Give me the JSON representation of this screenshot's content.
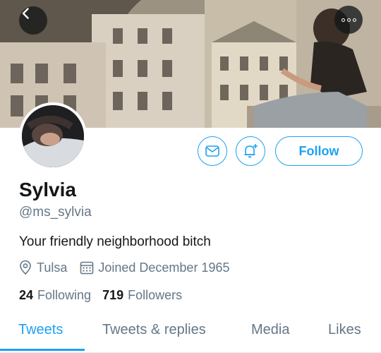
{
  "profile": {
    "display_name": "Sylvia",
    "handle": "@ms_sylvia",
    "bio": "Your friendly neighborhood bitch",
    "location": "Tulsa",
    "joined": "Joined December 1965",
    "following_count": "24",
    "following_label": "Following",
    "followers_count": "719",
    "followers_label": "Followers"
  },
  "actions": {
    "follow_label": "Follow"
  },
  "tabs": [
    {
      "label": "Tweets",
      "active": true
    },
    {
      "label": "Tweets & replies",
      "active": false
    },
    {
      "label": "Media",
      "active": false
    },
    {
      "label": "Likes",
      "active": false
    }
  ],
  "icons": {
    "back": "chevron-left-icon",
    "more": "more-horizontal-icon",
    "message": "mail-icon",
    "notifications": "bell-plus-icon",
    "location": "location-pin-icon",
    "joined": "calendar-icon"
  },
  "colors": {
    "accent": "#1da1f2",
    "secondary_text": "#657786",
    "primary_text": "#14171a"
  }
}
